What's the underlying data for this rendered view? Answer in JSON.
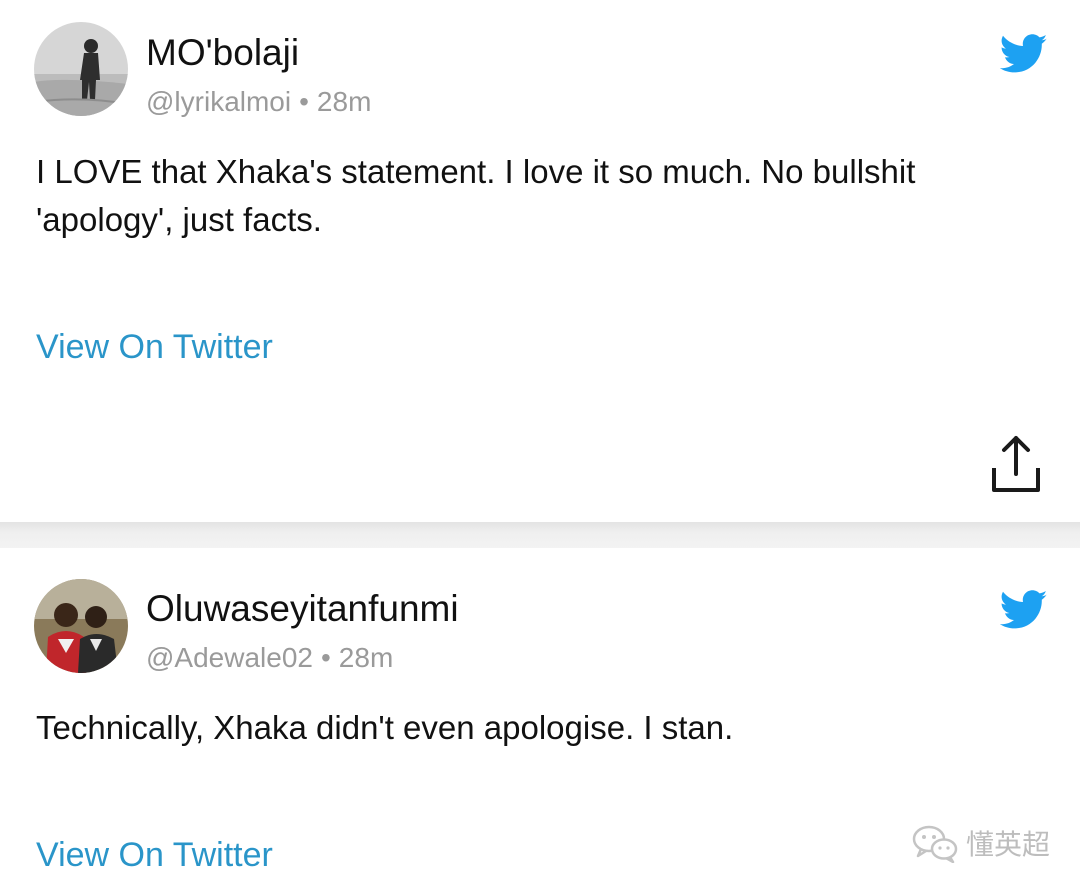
{
  "colors": {
    "link": "#2a95c9",
    "twitter_blue": "#1da1f2",
    "meta_gray": "#9a9a9a"
  },
  "tweets": [
    {
      "display_name": "MO'bolaji",
      "handle": "@lyrikalmoi",
      "separator": "•",
      "time": "28m",
      "text": "I LOVE that Xhaka's statement. I love it so much. No bullshit 'apology', just facts.",
      "link_label": "View On Twitter",
      "brand_icon": "twitter-bird-icon",
      "action_icon": "share-icon"
    },
    {
      "display_name": "Oluwaseyitanfunmi",
      "handle": "@Adewale02",
      "separator": "•",
      "time": "28m",
      "text": "Technically, Xhaka didn't even apologise. I stan.",
      "link_label": "View On Twitter",
      "brand_icon": "twitter-bird-icon"
    }
  ],
  "watermark": {
    "text": "懂英超",
    "icon": "wechat-icon"
  }
}
